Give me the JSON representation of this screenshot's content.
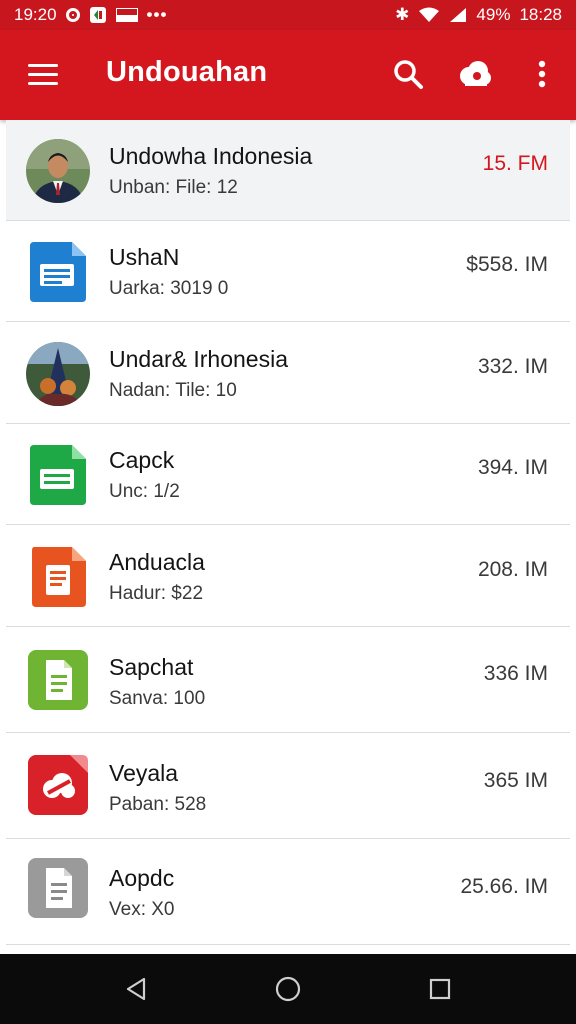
{
  "status_bar": {
    "time_left": "19:20",
    "signal_text": "49%",
    "time_right": "18:28",
    "overflow_glyph": "•••",
    "bluetooth_glyph": "✱"
  },
  "app_bar": {
    "title": "Undouahan",
    "icons": [
      "menu-icon",
      "search-icon",
      "cloud-icon",
      "more-vert-icon"
    ],
    "accent_color": "#d4171f"
  },
  "items": [
    {
      "title": "Undowha Indonesia",
      "subtitle": "Unban: File: 12",
      "size": "15. FM",
      "icon": "avatar-person"
    },
    {
      "title": "UshaN",
      "subtitle": "Uarka: 3019  0",
      "size": "$558. IM",
      "icon": "docs-icon"
    },
    {
      "title": "Undar& Irhonesia",
      "subtitle": "Nadan: Tile: 10",
      "size": "332. IM",
      "icon": "avatar-photo"
    },
    {
      "title": "Capck",
      "subtitle": "Unc: 1/2",
      "size": "394. IM",
      "icon": "sheets-icon"
    },
    {
      "title": "Anduacla",
      "subtitle": "Hadur: $22",
      "size": "208. IM",
      "icon": "slides-icon"
    },
    {
      "title": "Sapchat",
      "subtitle": "Sanva: 100",
      "size": "336 IM",
      "icon": "file-green-icon"
    },
    {
      "title": "Veyala",
      "subtitle": "Paban: 528",
      "size": "365 IM",
      "icon": "cloud-red-icon"
    },
    {
      "title": "Aopdc",
      "subtitle": "Vex: X0",
      "size": "25.66. IM",
      "icon": "file-grey-icon"
    }
  ],
  "nav_bar": {
    "icons": [
      "back-icon",
      "home-icon",
      "recents-icon"
    ]
  }
}
